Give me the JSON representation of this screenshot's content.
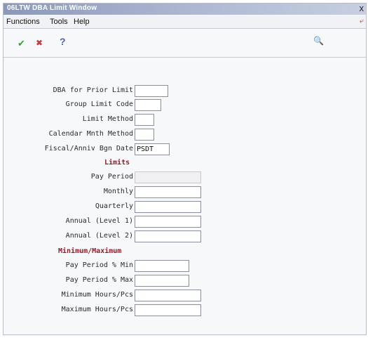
{
  "window": {
    "title": "06LTW    DBA Limit Window",
    "close_glyph": "x"
  },
  "menu": {
    "functions": "Functions",
    "tools": "Tools",
    "help": "Help"
  },
  "toolbar": {
    "ok_glyph": "✔",
    "cancel_glyph": "✖",
    "help_glyph": "?",
    "search_glyph": "🔍"
  },
  "form": {
    "dba_prior_limit": {
      "label": "DBA for Prior Limit",
      "value": ""
    },
    "group_limit_code": {
      "label": "Group Limit Code",
      "value": ""
    },
    "limit_method": {
      "label": "Limit Method",
      "value": ""
    },
    "calendar_month_method": {
      "label": "Calendar Mnth Method",
      "value": ""
    },
    "fiscal_anniv_begin_date": {
      "label": "Fiscal/Anniv Bgn Date",
      "value": "PSDT"
    },
    "limits_heading": "Limits",
    "pay_period": {
      "label": "Pay Period",
      "value": ""
    },
    "monthly": {
      "label": "Monthly",
      "value": ""
    },
    "quarterly": {
      "label": "Quarterly",
      "value": ""
    },
    "annual_level1": {
      "label": "Annual (Level 1)",
      "value": ""
    },
    "annual_level2": {
      "label": "Annual (Level 2)",
      "value": ""
    },
    "minmax_heading": "Minimum/Maximum",
    "pay_period_pct_min": {
      "label": "Pay Period % Min",
      "value": ""
    },
    "pay_period_pct_max": {
      "label": "Pay Period % Max",
      "value": ""
    },
    "minimum_hours_pcs": {
      "label": "Minimum Hours/Pcs",
      "value": ""
    },
    "maximum_hours_pcs": {
      "label": "Maximum Hours/Pcs",
      "value": ""
    }
  }
}
